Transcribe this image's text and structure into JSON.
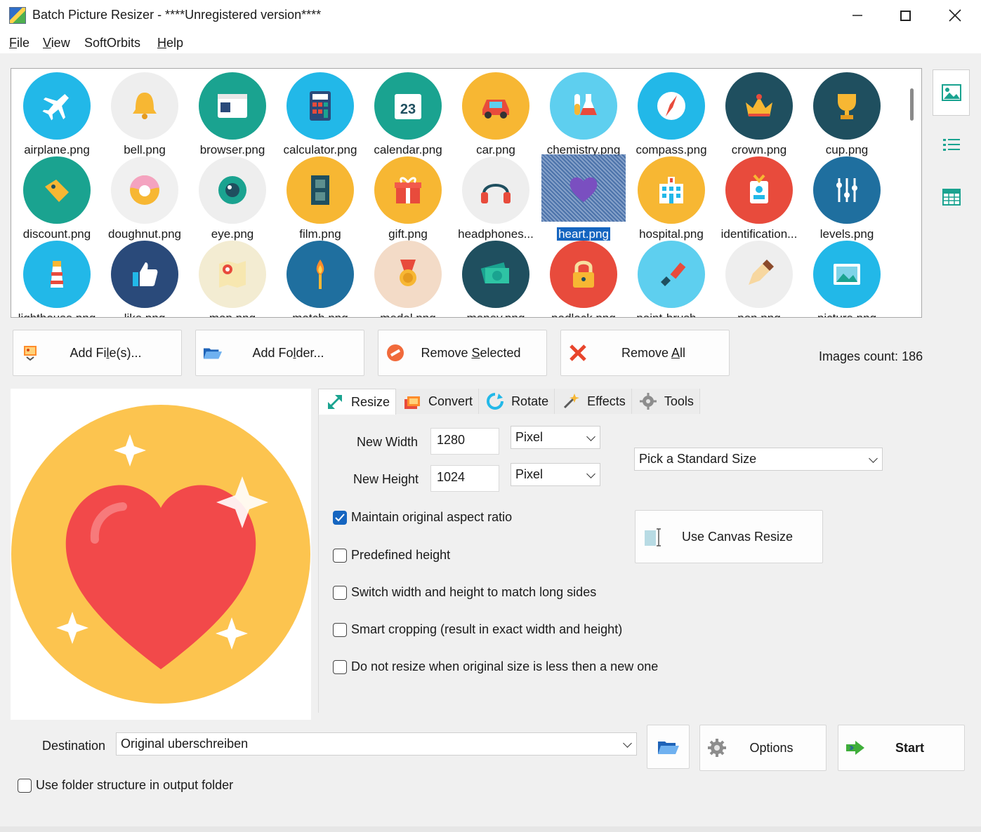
{
  "window": {
    "title": "Batch Picture Resizer - ****Unregistered version****",
    "minimize_icon": "minimize-icon",
    "maximize_icon": "maximize-icon",
    "close_icon": "close-icon"
  },
  "menu": {
    "file": {
      "u": "F",
      "rest": "ile"
    },
    "view": {
      "u": "V",
      "rest": "iew"
    },
    "softorbits": "SoftOrbits",
    "help": {
      "u": "H",
      "rest": "elp"
    }
  },
  "thumbnails": [
    {
      "label": "airplane.png",
      "color": "#22b8e8",
      "icon": "airplane-icon"
    },
    {
      "label": "bell.png",
      "color": "#eeeeee",
      "icon": "bell-icon"
    },
    {
      "label": "browser.png",
      "color": "#1aa390",
      "icon": "browser-icon"
    },
    {
      "label": "calculator.png",
      "color": "#22b8e8",
      "icon": "calculator-icon"
    },
    {
      "label": "calendar.png",
      "color": "#1aa390",
      "icon": "calendar-icon"
    },
    {
      "label": "car.png",
      "color": "#f7b733",
      "icon": "car-icon"
    },
    {
      "label": "chemistry.png",
      "color": "#5ecfef",
      "icon": "chemistry-icon"
    },
    {
      "label": "compass.png",
      "color": "#22b8e8",
      "icon": "compass-icon"
    },
    {
      "label": "crown.png",
      "color": "#1f4f5f",
      "icon": "crown-icon"
    },
    {
      "label": "cup.png",
      "color": "#1f4f5f",
      "icon": "cup-icon"
    },
    {
      "label": "discount.png",
      "color": "#1aa390",
      "icon": "discount-icon"
    },
    {
      "label": "doughnut.png",
      "color": "#f0f0f0",
      "icon": "doughnut-icon"
    },
    {
      "label": "eye.png",
      "color": "#eeeeee",
      "icon": "eye-icon"
    },
    {
      "label": "film.png",
      "color": "#f7b733",
      "icon": "film-icon"
    },
    {
      "label": "gift.png",
      "color": "#f7b733",
      "icon": "gift-icon"
    },
    {
      "label": "headphones...",
      "color": "#eeeeee",
      "icon": "headphones-icon"
    },
    {
      "label": "heart.png",
      "color": "#f7b733",
      "icon": "heart-icon",
      "selected": true
    },
    {
      "label": "hospital.png",
      "color": "#f7b733",
      "icon": "hospital-icon"
    },
    {
      "label": "identification...",
      "color": "#e84b3c",
      "icon": "id-card-icon"
    },
    {
      "label": "levels.png",
      "color": "#1f6f9f",
      "icon": "levels-icon"
    },
    {
      "label": "lighthouse.png",
      "color": "#22b8e8",
      "icon": "lighthouse-icon"
    },
    {
      "label": "like.png",
      "color": "#2a4a7a",
      "icon": "like-icon"
    },
    {
      "label": "map.png",
      "color": "#f3ecd2",
      "icon": "map-icon"
    },
    {
      "label": "match.png",
      "color": "#1f6f9f",
      "icon": "match-icon"
    },
    {
      "label": "medal.png",
      "color": "#f3dbc7",
      "icon": "medal-icon"
    },
    {
      "label": "money.png",
      "color": "#1f4f5f",
      "icon": "money-icon"
    },
    {
      "label": "padlock.png",
      "color": "#e84b3c",
      "icon": "padlock-icon"
    },
    {
      "label": "paint-brush...",
      "color": "#5ecfef",
      "icon": "paint-brush-icon"
    },
    {
      "label": "pen.png",
      "color": "#eeeeee",
      "icon": "pen-icon"
    },
    {
      "label": "picture.png",
      "color": "#22b8e8",
      "icon": "picture-icon"
    }
  ],
  "side_toolbar": {
    "thumbnail_view_icon": "thumbnail-view-icon",
    "list_view_icon": "list-view-icon",
    "table_view_icon": "table-view-icon"
  },
  "actions": {
    "add_files": {
      "pre": "Add Fi",
      "u": "l",
      "post": "e(s)..."
    },
    "add_folder": {
      "pre": "Add Fo",
      "u": "l",
      "post": "der..."
    },
    "remove_selected": {
      "pre": "Remove ",
      "u": "S",
      "post": "elected"
    },
    "remove_all": {
      "pre": "Remove ",
      "u": "A",
      "post": "ll"
    },
    "images_count": "Images count: 186"
  },
  "tabs": [
    {
      "label": "Resize",
      "icon": "resize-icon",
      "active": true
    },
    {
      "label": "Convert",
      "icon": "convert-icon"
    },
    {
      "label": "Rotate",
      "icon": "rotate-icon"
    },
    {
      "label": "Effects",
      "icon": "effects-icon"
    },
    {
      "label": "Tools",
      "icon": "tools-icon"
    }
  ],
  "resize": {
    "new_width_label": "New Width",
    "new_width_value": "1280",
    "new_height_label": "New Height",
    "new_height_value": "1024",
    "width_unit": "Pixel",
    "height_unit": "Pixel",
    "standard_size": "Pick a Standard Size",
    "canvas_resize": "Use Canvas Resize",
    "maintain_aspect": "Maintain original aspect ratio",
    "predefined_height": "Predefined height",
    "switch_sides": "Switch width and height to match long sides",
    "smart_cropping": "Smart cropping (result in exact width and height)",
    "no_upscale": "Do not resize when original size is less then a new one"
  },
  "bottom": {
    "destination_label": "Destination",
    "destination_value": "Original uberschreiben",
    "options": "Options",
    "start": "Start",
    "use_folder_structure": "Use folder structure in output folder"
  },
  "colors": {
    "accent": "#1565c0",
    "preview_circle": "#fcc44f",
    "preview_heart": "#f2494a"
  }
}
